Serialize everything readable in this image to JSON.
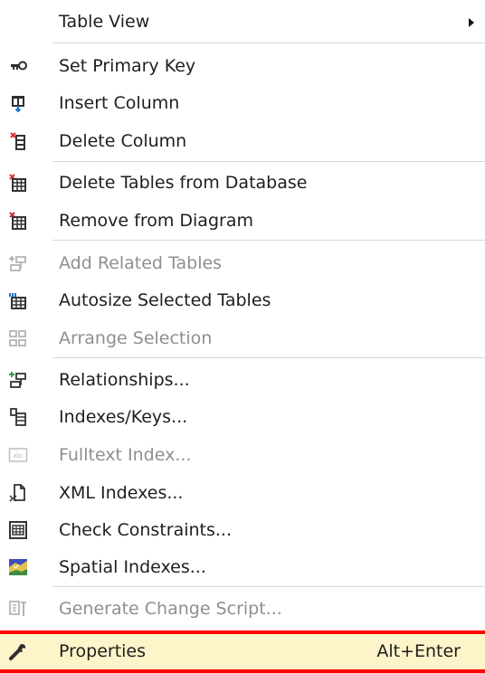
{
  "menu": {
    "items": [
      {
        "label": "Table View",
        "icon": "none",
        "disabled": false,
        "submenu": true
      },
      {
        "label": "Set Primary Key",
        "icon": "key-icon",
        "disabled": false
      },
      {
        "label": "Insert Column",
        "icon": "insert-column-icon",
        "disabled": false
      },
      {
        "label": "Delete Column",
        "icon": "delete-column-icon",
        "disabled": false
      },
      {
        "label": "Delete Tables from Database",
        "icon": "delete-table-icon",
        "disabled": false
      },
      {
        "label": "Remove from Diagram",
        "icon": "remove-table-icon",
        "disabled": false
      },
      {
        "label": "Add Related Tables",
        "icon": "add-related-tables-icon",
        "disabled": true
      },
      {
        "label": "Autosize Selected Tables",
        "icon": "autosize-icon",
        "disabled": false
      },
      {
        "label": "Arrange Selection",
        "icon": "arrange-icon",
        "disabled": true
      },
      {
        "label": "Relationships...",
        "icon": "relationships-icon",
        "disabled": false
      },
      {
        "label": "Indexes/Keys...",
        "icon": "indexes-icon",
        "disabled": false
      },
      {
        "label": "Fulltext Index...",
        "icon": "fulltext-icon",
        "disabled": true
      },
      {
        "label": "XML Indexes...",
        "icon": "xml-index-icon",
        "disabled": false
      },
      {
        "label": "Check Constraints...",
        "icon": "check-constraints-icon",
        "disabled": false
      },
      {
        "label": "Spatial Indexes...",
        "icon": "spatial-index-icon",
        "disabled": false
      },
      {
        "label": "Generate Change Script...",
        "icon": "script-icon",
        "disabled": true
      },
      {
        "label": "Properties",
        "icon": "wrench-icon",
        "disabled": false,
        "highlighted": true,
        "shortcut": "Alt+Enter"
      }
    ]
  },
  "colors": {
    "text": "#1e1e1e",
    "disabled_text": "#8f8f8f",
    "highlight": "#fdf4c9",
    "highlight_border": "#ff0000",
    "separator": "#d7d7d7"
  }
}
